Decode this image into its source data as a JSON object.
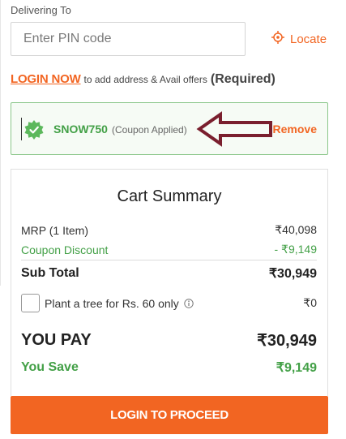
{
  "delivery": {
    "label": "Delivering To",
    "pin_placeholder": "Enter PIN code",
    "locate_label": "Locate"
  },
  "login_prompt": {
    "link": "LOGIN NOW",
    "text": "to add address & Avail offers",
    "required": "(Required)"
  },
  "coupon": {
    "code": "SNOW750",
    "status": "(Coupon Applied)",
    "remove_label": "Remove"
  },
  "cart_summary": {
    "title": "Cart Summary",
    "mrp_label": "MRP (1 Item)",
    "mrp_value": "₹40,098",
    "discount_label": "Coupon Discount",
    "discount_value": "- ₹9,149",
    "subtotal_label": "Sub Total",
    "subtotal_value": "₹30,949",
    "tree_label": "Plant a tree for Rs. 60 only",
    "tree_value": "₹0",
    "tree_checked": false,
    "pay_label": "YOU PAY",
    "pay_value": "₹30,949",
    "save_label": "You Save",
    "save_value": "₹9,149"
  },
  "proceed_button": "LOGIN TO PROCEED",
  "colors": {
    "accent": "#f26522",
    "success": "#43a047",
    "annotation_arrow": "#7a1f2e",
    "coupon_border": "#8bc78a"
  },
  "icons": {
    "locate": "crosshair-icon",
    "coupon_badge": "check-badge-icon",
    "annotation": "left-arrow-icon",
    "info": "info-icon"
  }
}
